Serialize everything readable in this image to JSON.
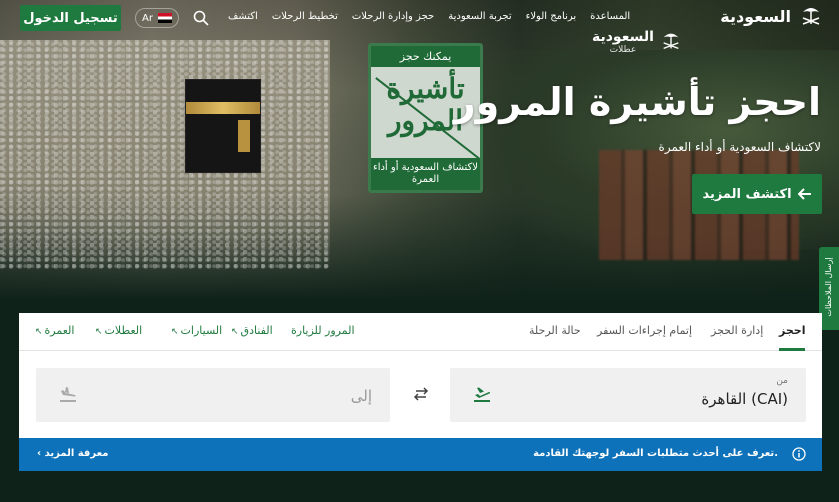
{
  "nav": {
    "logo_text": "السعودية",
    "links": [
      "اكتشف",
      "تخطيط الرحلات",
      "حجز وإدارة الرحلات",
      "تجربة السعودية",
      "برنامج الولاء",
      "المساعدة"
    ],
    "language": "Ar",
    "login_label": "تسجيل الدخول",
    "holidays_logo": "السعودية",
    "holidays_sub": "عطلات"
  },
  "hero": {
    "title": "احجز تأشيرة المرور",
    "subtitle": "لاكتشاف السعودية أو أداء العمرة",
    "cta_label": "اكتشف المزيد",
    "sign": {
      "top": "يمكنك حجز",
      "big": "تأشيرة المرور",
      "bottom": "لاكتشاف السعودية أو أداء العمرة"
    }
  },
  "feedback_label": "إرسال الملاحظات",
  "booking": {
    "tabs_right": [
      "احجز",
      "إدارة الحجز",
      "إتمام إجراءات السفر",
      "حالة الرحلة"
    ],
    "active_tab": "احجز",
    "tabs_left": [
      "المرور للزيارة",
      "الفنادق",
      "السيارات",
      "العطلات",
      "العمرة"
    ],
    "from_label": "من",
    "from_value": "القاهرة (CAI)",
    "to_placeholder": "إلى"
  },
  "info_bar": {
    "text": "تعرف على أحدث متطلبات السفر لوجهتك القادمة.",
    "link": "معرفة المزيد"
  },
  "colors": {
    "brand_green": "#1f7a3f",
    "info_blue": "#0d72b9"
  }
}
